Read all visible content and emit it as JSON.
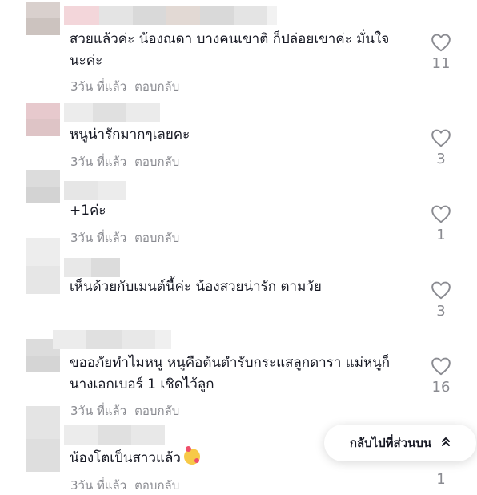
{
  "comments": [
    {
      "text": "สวยแล้วค่ะ น้องณดา บางคนเขาติ ก็ปล่อยเขาค่ะ มั่นใจนะค่ะ",
      "time": "3วัน ที่แล้ว",
      "reply": "ตอบกลับ",
      "likes": "11"
    },
    {
      "text": "หนูน่ารักมากๆเลยคะ",
      "time": "3วัน ที่แล้ว",
      "reply": "ตอบกลับ",
      "likes": "3"
    },
    {
      "text": "+1ค่ะ",
      "time": "3วัน ที่แล้ว",
      "reply": "ตอบกลับ",
      "likes": "1"
    },
    {
      "text": "เห็นด้วยกับเมนต์นี้ค่ะ น้องสวยน่ารัก ตามวัย",
      "time": "",
      "reply": "",
      "likes": "3"
    },
    {
      "text": "ขออภัยทำไมหนู หนูคือต้นตำรับกระแสลูกดารา แม่หนูก็นางเอกเบอร์ 1 เชิดไว้ลูก",
      "time": "3วัน ที่แล้ว",
      "reply": "ตอบกลับ",
      "likes": "16"
    },
    {
      "text": "น้องโตเป็นสาวแล้ว",
      "time": "3วัน ที่แล้ว",
      "reply": "ตอบกลับ",
      "likes": "1"
    }
  ],
  "back_to_top": {
    "label": "กลับไปที่ส่วนบน",
    "icon": "chevrons-up-icon"
  },
  "icons": {
    "like": "heart-outline-icon",
    "emoji": "smiling-face-with-hearts-emoji"
  },
  "colors": {
    "text": "#161823",
    "muted": "#8a8b91"
  }
}
